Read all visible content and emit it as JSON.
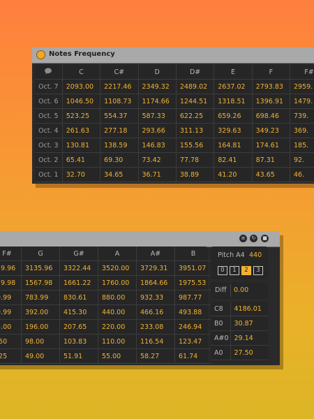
{
  "top_window": {
    "title": "Notes Frequency",
    "columns": [
      "C",
      "C#",
      "D",
      "D#",
      "E",
      "F",
      "F#"
    ],
    "rows": [
      {
        "octave": "Oct. 7",
        "values": [
          "2093.00",
          "2217.46",
          "2349.32",
          "2489.02",
          "2637.02",
          "2793.83",
          "2959."
        ]
      },
      {
        "octave": "Oct. 6",
        "values": [
          "1046.50",
          "1108.73",
          "1174.66",
          "1244.51",
          "1318.51",
          "1396.91",
          "1479."
        ]
      },
      {
        "octave": "Oct. 5",
        "values": [
          "523.25",
          "554.37",
          "587.33",
          "622.25",
          "659.26",
          "698.46",
          "739."
        ]
      },
      {
        "octave": "Oct. 4",
        "values": [
          "261.63",
          "277.18",
          "293.66",
          "311.13",
          "329.63",
          "349.23",
          "369."
        ]
      },
      {
        "octave": "Oct. 3",
        "values": [
          "130.81",
          "138.59",
          "146.83",
          "155.56",
          "164.81",
          "174.61",
          "185."
        ]
      },
      {
        "octave": "Oct. 2",
        "values": [
          "65.41",
          "69.30",
          "73.42",
          "77.78",
          "82.41",
          "87.31",
          "92."
        ]
      },
      {
        "octave": "Oct. 1",
        "values": [
          "32.70",
          "34.65",
          "36.71",
          "38.89",
          "41.20",
          "43.65",
          "46."
        ]
      }
    ]
  },
  "bottom_window": {
    "columns": [
      "F#",
      "G",
      "G#",
      "A",
      "A#",
      "B"
    ],
    "rows": [
      [
        "59.96",
        "3135.96",
        "3322.44",
        "3520.00",
        "3729.31",
        "3951.07"
      ],
      [
        "79.98",
        "1567.98",
        "1661.22",
        "1760.00",
        "1864.66",
        "1975.53"
      ],
      [
        "9.99",
        "783.99",
        "830.61",
        "880.00",
        "932.33",
        "987.77"
      ],
      [
        "9.99",
        "392.00",
        "415.30",
        "440.00",
        "466.16",
        "493.88"
      ],
      [
        "5.00",
        "196.00",
        "207.65",
        "220.00",
        "233.08",
        "246.94"
      ],
      [
        ".50",
        "98.00",
        "103.83",
        "110.00",
        "116.54",
        "123.47"
      ],
      [
        ".25",
        "49.00",
        "51.91",
        "55.00",
        "58.27",
        "61.74"
      ]
    ],
    "pitch_label": "Pitch A4",
    "pitch_value": "440",
    "octave_buttons": [
      "0",
      "1",
      "2",
      "3"
    ],
    "selected_octave": "2",
    "diff_label": "Diff",
    "diff_value": "0.00",
    "references": [
      {
        "note": "C8",
        "value": "4186.01"
      },
      {
        "note": "B0",
        "value": "30.87"
      },
      {
        "note": "A#0",
        "value": "29.14"
      },
      {
        "note": "A0",
        "value": "27.50"
      }
    ]
  },
  "colors": {
    "accent": "#f2b233",
    "background_top": "#ff7f3e",
    "background_bottom": "#dcb625"
  },
  "icons": [
    "speech-bubble-icon",
    "window-dot-icon",
    "fold-icon",
    "reload-icon",
    "save-icon"
  ]
}
